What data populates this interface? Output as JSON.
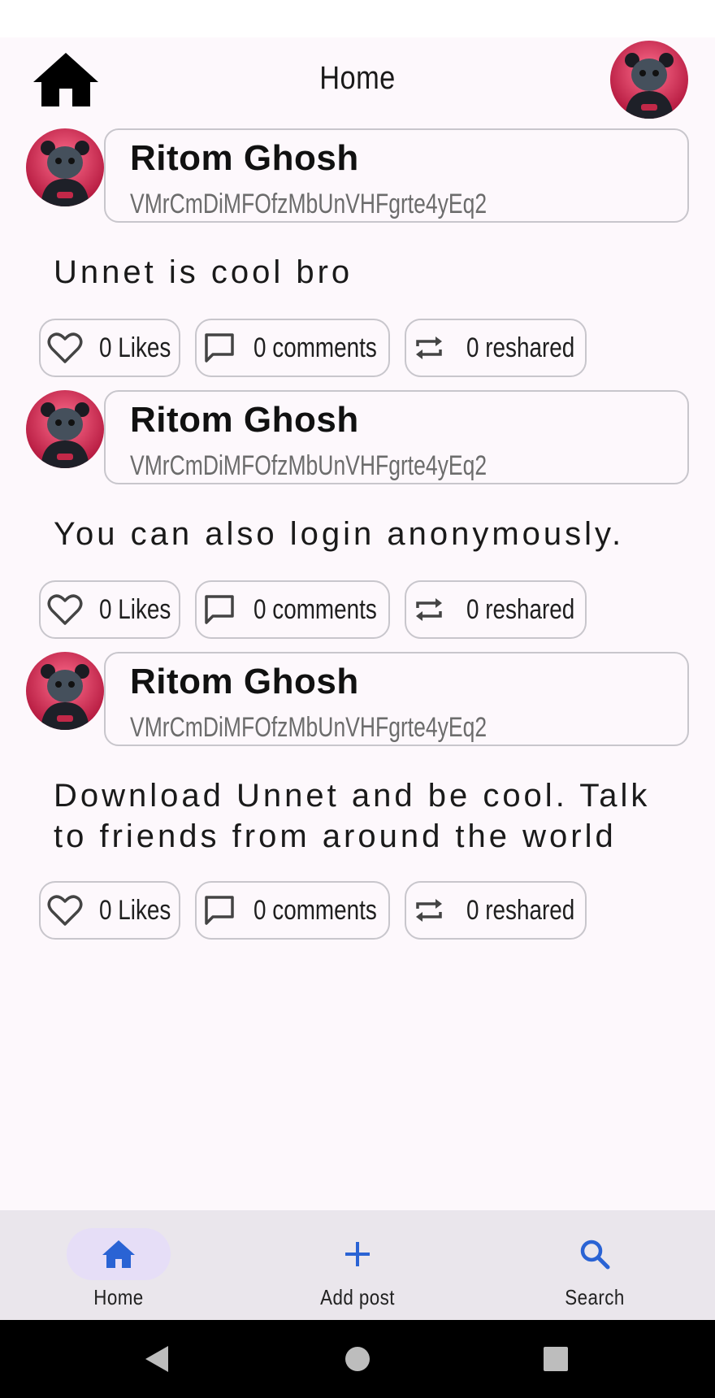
{
  "appbar": {
    "title": "Home"
  },
  "posts": [
    {
      "author": "Ritom Ghosh",
      "user_id": "VMrCmDiMFOfzMbUnVHFgrte4yEq2",
      "text": "Unnet is cool bro",
      "likes": "0 Likes",
      "comments": "0 comments",
      "reshared": "0 reshared"
    },
    {
      "author": "Ritom Ghosh",
      "user_id": "VMrCmDiMFOfzMbUnVHFgrte4yEq2",
      "text": "You can also login anonymously.",
      "likes": "0 Likes",
      "comments": "0 comments",
      "reshared": "0 reshared"
    },
    {
      "author": "Ritom Ghosh",
      "user_id": "VMrCmDiMFOfzMbUnVHFgrte4yEq2",
      "text": "Download Unnet and be cool. Talk to friends from around the world",
      "likes": "0 Likes",
      "comments": "0 comments",
      "reshared": "0 reshared"
    }
  ],
  "bottom_nav": {
    "items": [
      {
        "label": "Home",
        "icon": "home-icon",
        "active": true
      },
      {
        "label": "Add post",
        "icon": "plus-icon",
        "active": false
      },
      {
        "label": "Search",
        "icon": "search-icon",
        "active": false
      }
    ]
  },
  "colors": {
    "accent": "#2a63d4",
    "active_pill": "#e6def7",
    "nav_bg": "#eae6ec",
    "background": "#fdf8fc"
  }
}
